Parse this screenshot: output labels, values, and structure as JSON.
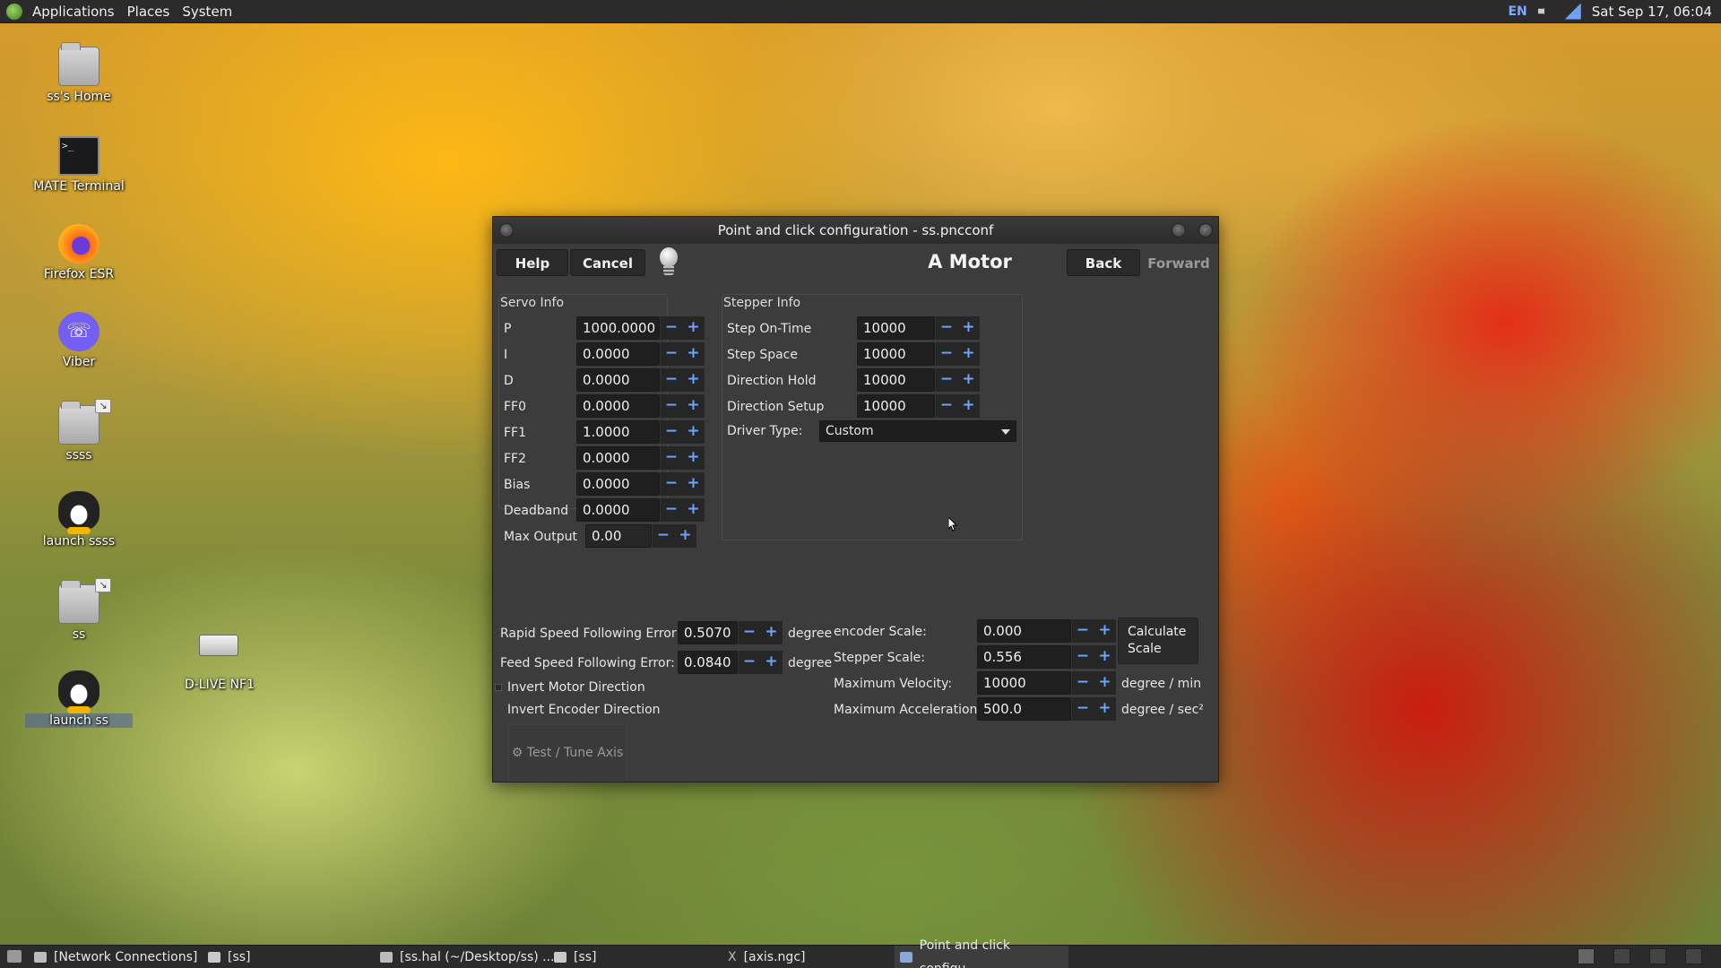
{
  "top_panel": {
    "menus": [
      "Applications",
      "Places",
      "System"
    ],
    "lang": "EN",
    "clock": "Sat Sep 17, 06:04"
  },
  "desktop_icons": [
    {
      "label": "ss's Home"
    },
    {
      "label": "MATE Terminal"
    },
    {
      "label": "Firefox ESR"
    },
    {
      "label": "Viber"
    },
    {
      "label": "ssss"
    },
    {
      "label": "launch ssss"
    },
    {
      "label": "ss"
    },
    {
      "label": "launch ss"
    },
    {
      "label": "D-LIVE NF1"
    }
  ],
  "dialog": {
    "title": "Point and click configuration - ss.pncconf",
    "help": "Help",
    "cancel": "Cancel",
    "page_title": "A Motor",
    "back": "Back",
    "forward": "Forward",
    "servo_info": {
      "title": "Servo Info",
      "rows": [
        {
          "label": "P",
          "value": "1000.0000"
        },
        {
          "label": "I",
          "value": "0.0000"
        },
        {
          "label": "D",
          "value": "0.0000"
        },
        {
          "label": "FF0",
          "value": "0.0000"
        },
        {
          "label": "FF1",
          "value": "1.0000"
        },
        {
          "label": "FF2",
          "value": "0.0000"
        },
        {
          "label": "Bias",
          "value": "0.0000"
        },
        {
          "label": "Deadband",
          "value": "0.0000"
        },
        {
          "label": "Max Output",
          "value": "0.00"
        }
      ]
    },
    "stepper_info": {
      "title": "Stepper Info",
      "rows": [
        {
          "label": "Step On-Time",
          "value": "10000"
        },
        {
          "label": "Step Space",
          "value": "10000"
        },
        {
          "label": "Direction Hold",
          "value": "10000"
        },
        {
          "label": "Direction Setup",
          "value": "10000"
        }
      ],
      "driver_type_label": "Driver Type:",
      "driver_type_value": "Custom"
    },
    "rapid_error": {
      "label": "Rapid Speed Following Error:",
      "value": "0.5070",
      "unit": "degree"
    },
    "feed_error": {
      "label": "Feed Speed Following Error:",
      "value": "0.0840",
      "unit": "degree"
    },
    "invert_motor": "Invert Motor Direction",
    "invert_encoder": "Invert Encoder Direction",
    "test_tune": "Test / Tune Axis",
    "encoder_scale": {
      "label": "encoder Scale:",
      "value": "0.000"
    },
    "stepper_scale": {
      "label": "Stepper Scale:",
      "value": "0.556"
    },
    "max_velocity": {
      "label": "Maximum Velocity:",
      "value": "10000",
      "unit": "degree / min"
    },
    "max_accel": {
      "label": "Maximum Acceleration:",
      "value": "500.0",
      "unit": "degree / sec²"
    },
    "calculate_scale": "Calculate Scale",
    "spin_minus": "−",
    "spin_plus": "+"
  },
  "taskbar": {
    "tasks": [
      "[Network Connections]",
      "[ss]",
      "[ss.hal (~/Desktop/ss) ...",
      "[ss]",
      "[axis.ngc]",
      "Point and click configu..."
    ]
  }
}
